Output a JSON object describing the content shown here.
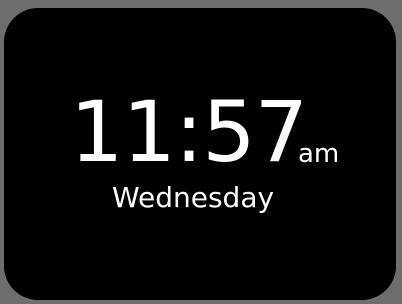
{
  "clock": {
    "time": "11:57",
    "period": "am",
    "day": "Wednesday"
  },
  "colors": {
    "background": "#000000",
    "text": "#ffffff",
    "frame": "#6e6e6e"
  }
}
